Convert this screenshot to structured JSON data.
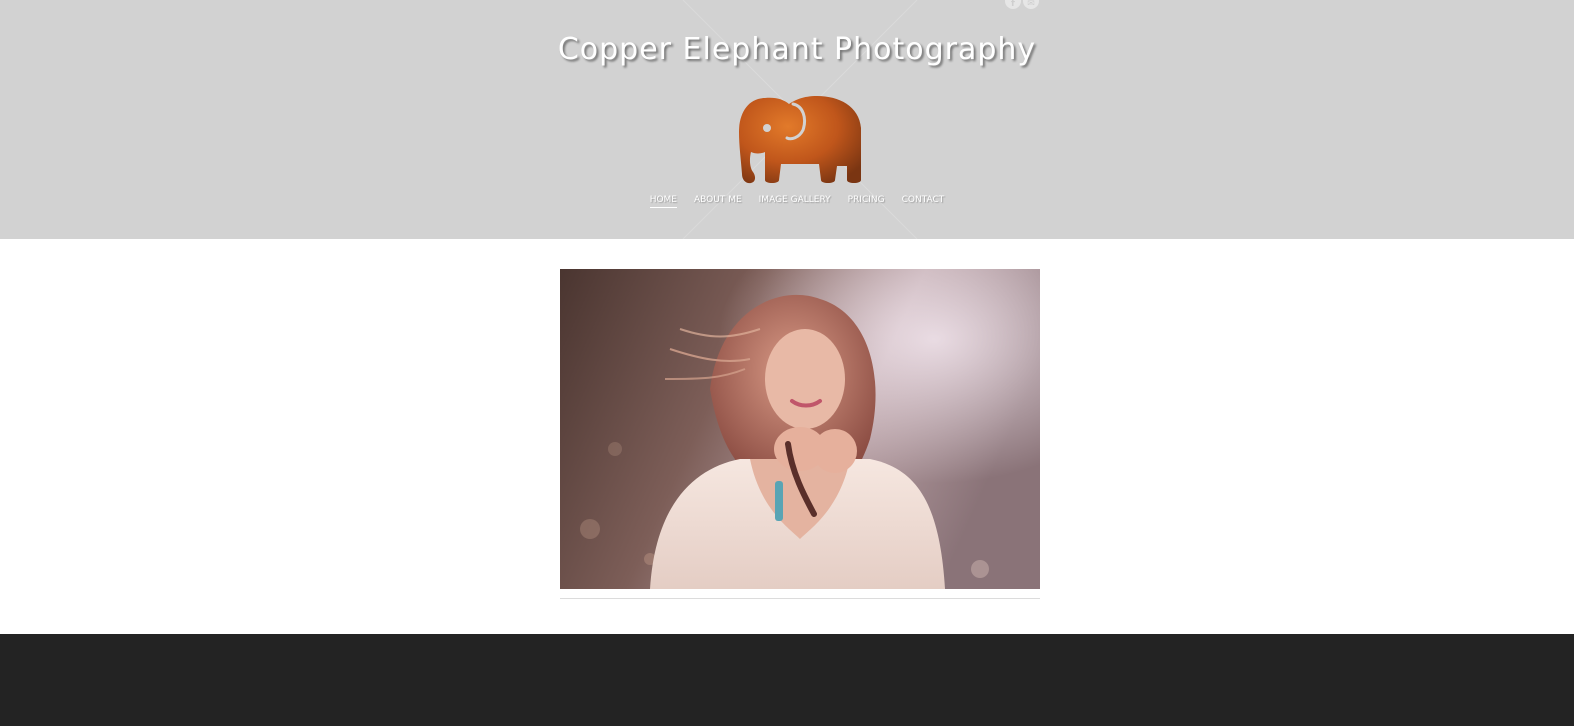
{
  "site": {
    "title": "Copper Elephant Photography"
  },
  "social": [
    {
      "icon": "facebook-icon",
      "glyph": "f"
    },
    {
      "icon": "email-icon",
      "glyph": "✉"
    }
  ],
  "nav": {
    "items": [
      {
        "label": "HOME",
        "active": true
      },
      {
        "label": "ABOUT ME",
        "active": false
      },
      {
        "label": "IMAGE GALLERY",
        "active": false
      },
      {
        "label": "PRICING",
        "active": false
      },
      {
        "label": "CONTACT",
        "active": false
      }
    ]
  },
  "colors": {
    "header_bg": "#d2d2d2",
    "footer_bg": "#232323",
    "logo_copper": "#c0561b"
  }
}
